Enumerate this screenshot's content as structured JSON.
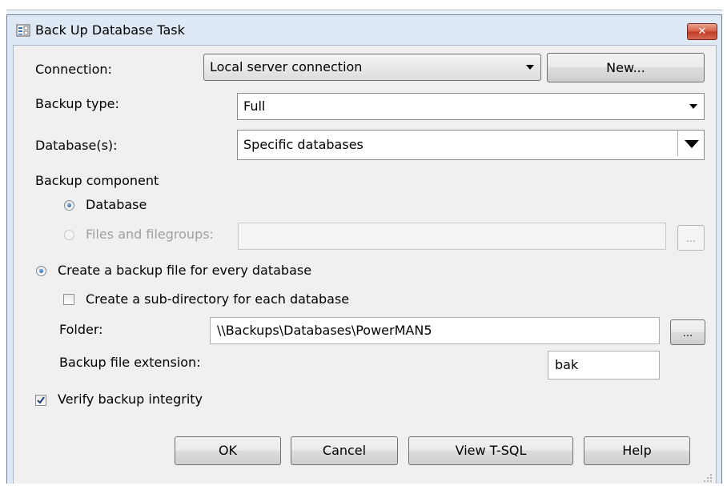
{
  "window": {
    "title": "Back Up Database Task",
    "close_label": "✕"
  },
  "form": {
    "connection_label": "Connection:",
    "connection_value": "Local server connection",
    "new_button": "New...",
    "backup_type_label": "Backup type:",
    "backup_type_value": "Full",
    "databases_label": "Database(s):",
    "databases_value": "Specific databases",
    "backup_component_label": "Backup component",
    "component_database_label": "Database",
    "component_files_label": "Files and filegroups:",
    "files_browse_label": "...",
    "create_file_every_db_label": "Create a backup file for every database",
    "create_subdir_label": "Create a sub-directory for each database",
    "folder_label": "Folder:",
    "folder_value": "\\\\Backups\\Databases\\PowerMAN5",
    "folder_browse_label": "...",
    "extension_label": "Backup file extension:",
    "extension_value": "bak",
    "verify_label": "Verify backup integrity"
  },
  "state": {
    "component_database_selected": true,
    "component_files_selected": false,
    "create_file_every_db_selected": true,
    "create_subdir_checked": false,
    "verify_checked": true
  },
  "buttons": {
    "ok": "OK",
    "cancel": "Cancel",
    "view_tsql": "View T-SQL",
    "help": "Help"
  },
  "icons": {
    "title_icon": "task-form-icon",
    "close_icon": "close-icon",
    "dropdown_icon": "chevron-down-icon",
    "resize_grip": "resize-grip-icon"
  }
}
